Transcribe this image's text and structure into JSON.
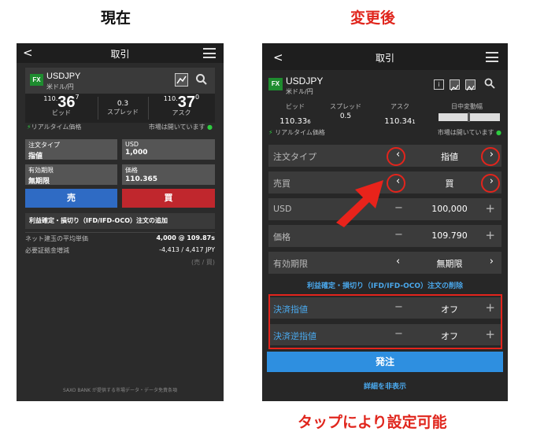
{
  "captions": {
    "left": "現在",
    "right": "変更後",
    "bottom": "タップにより設定可能"
  },
  "colors": {
    "accent_red": "#e0261d",
    "buy_red": "#c0272d",
    "sell_blue": "#2f6bc4",
    "order_blue": "#2e8fe0",
    "fx_green": "#1e8c2f",
    "status_green": "#2ecc40"
  },
  "left": {
    "header": {
      "back": "<",
      "title": "取引"
    },
    "symbol": {
      "badge": "FX",
      "name": "USDJPY",
      "sub": "米ドル/円"
    },
    "bid": {
      "prefix": "110.",
      "big": "36",
      "sup": "7",
      "label": "ビッド"
    },
    "spread": {
      "value": "0.3",
      "label": "スプレッド"
    },
    "ask": {
      "prefix": "110.",
      "big": "37",
      "sup": "0",
      "label": "アスク"
    },
    "realtime": "リアルタイム価格",
    "market": "市場は開いています",
    "fields": [
      {
        "label": "注文タイプ",
        "value": "指値"
      },
      {
        "label": "USD",
        "value": "1,000"
      },
      {
        "label": "有効期限",
        "value": "無期限"
      },
      {
        "label": "価格",
        "value": "110.365"
      }
    ],
    "sell": "売",
    "buy": "買",
    "add_link": "利益確定・損切り（IFD/IFD-OCO）注文の追加",
    "info": [
      {
        "label": "ネット建玉の平均単価",
        "value": "4,000 @ 109.87s"
      },
      {
        "label": "必要証拠金増減",
        "value": "-4,413 / 4,417  JPY"
      }
    ],
    "sellbuy": "(売 / 買)",
    "footer": "SAXO BANK が提供する市場データ・データ免責条項"
  },
  "right": {
    "header": {
      "back": "<",
      "title": "取引"
    },
    "symbol": {
      "badge": "FX",
      "name": "USDJPY",
      "sub": "米ドル/円"
    },
    "cols": {
      "bid_label": "ビッド",
      "spread_label": "スプレッド",
      "ask_label": "アスク",
      "range_label": "日中変動幅"
    },
    "bid": {
      "main": "110.33",
      "small": "6"
    },
    "spread": "0.5",
    "ask": {
      "main": "110.34",
      "small": "1"
    },
    "realtime": "リアルタイム価格",
    "market": "市場は開いています",
    "rows": {
      "order_type": {
        "label": "注文タイプ",
        "value": "指値"
      },
      "side": {
        "label": "売買",
        "value": "買"
      },
      "usd": {
        "label": "USD",
        "value": "100,000"
      },
      "price": {
        "label": "価格",
        "value": "109.790"
      },
      "expiry": {
        "label": "有効期限",
        "value": "無期限"
      }
    },
    "delete_link": "利益確定・損切り（IFD/IFD-OCO）注文の削除",
    "settle_limit": {
      "label": "決済指値",
      "value": "オフ"
    },
    "settle_stop": {
      "label": "決済逆指値",
      "value": "オフ"
    },
    "order_button": "発注",
    "hide_details": "詳細を非表示"
  }
}
